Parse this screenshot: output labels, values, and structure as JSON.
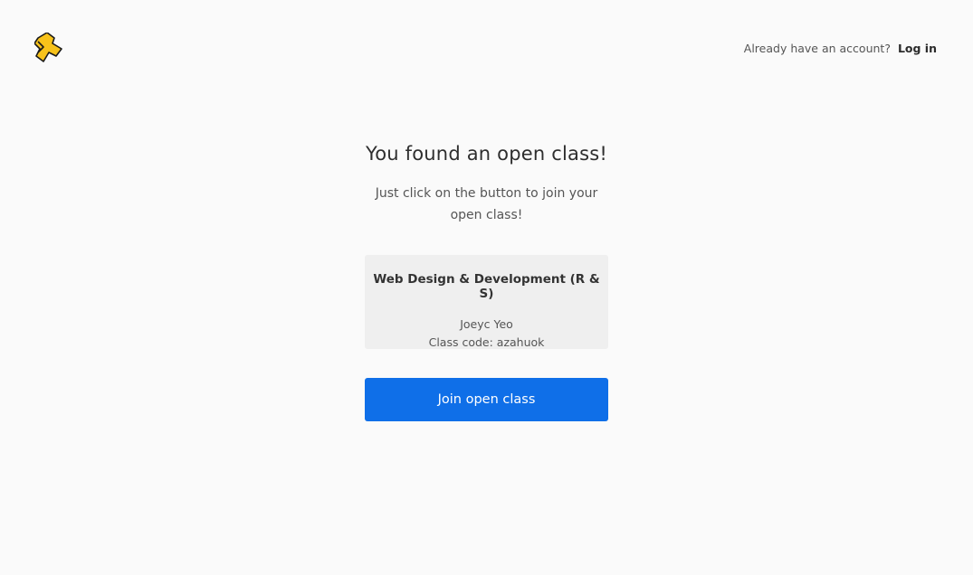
{
  "header": {
    "logo_icon": "weebly-style-puzzle-logo",
    "account_prompt": "Already have an account?",
    "login_label": "Log in"
  },
  "main": {
    "headline": "You found an open class!",
    "subtitle": "Just click on the button to join your open class!",
    "class_card": {
      "class_name": "Web Design & Development (R & S)",
      "teacher": "Joeyc Yeo",
      "class_code_label": "Class code: azahuok"
    },
    "join_button_label": "Join open class"
  },
  "colors": {
    "background": "#fafafa",
    "primary_button": "#0f6fe8",
    "card_background": "#efefef",
    "logo_fill": "#f7c21a"
  }
}
